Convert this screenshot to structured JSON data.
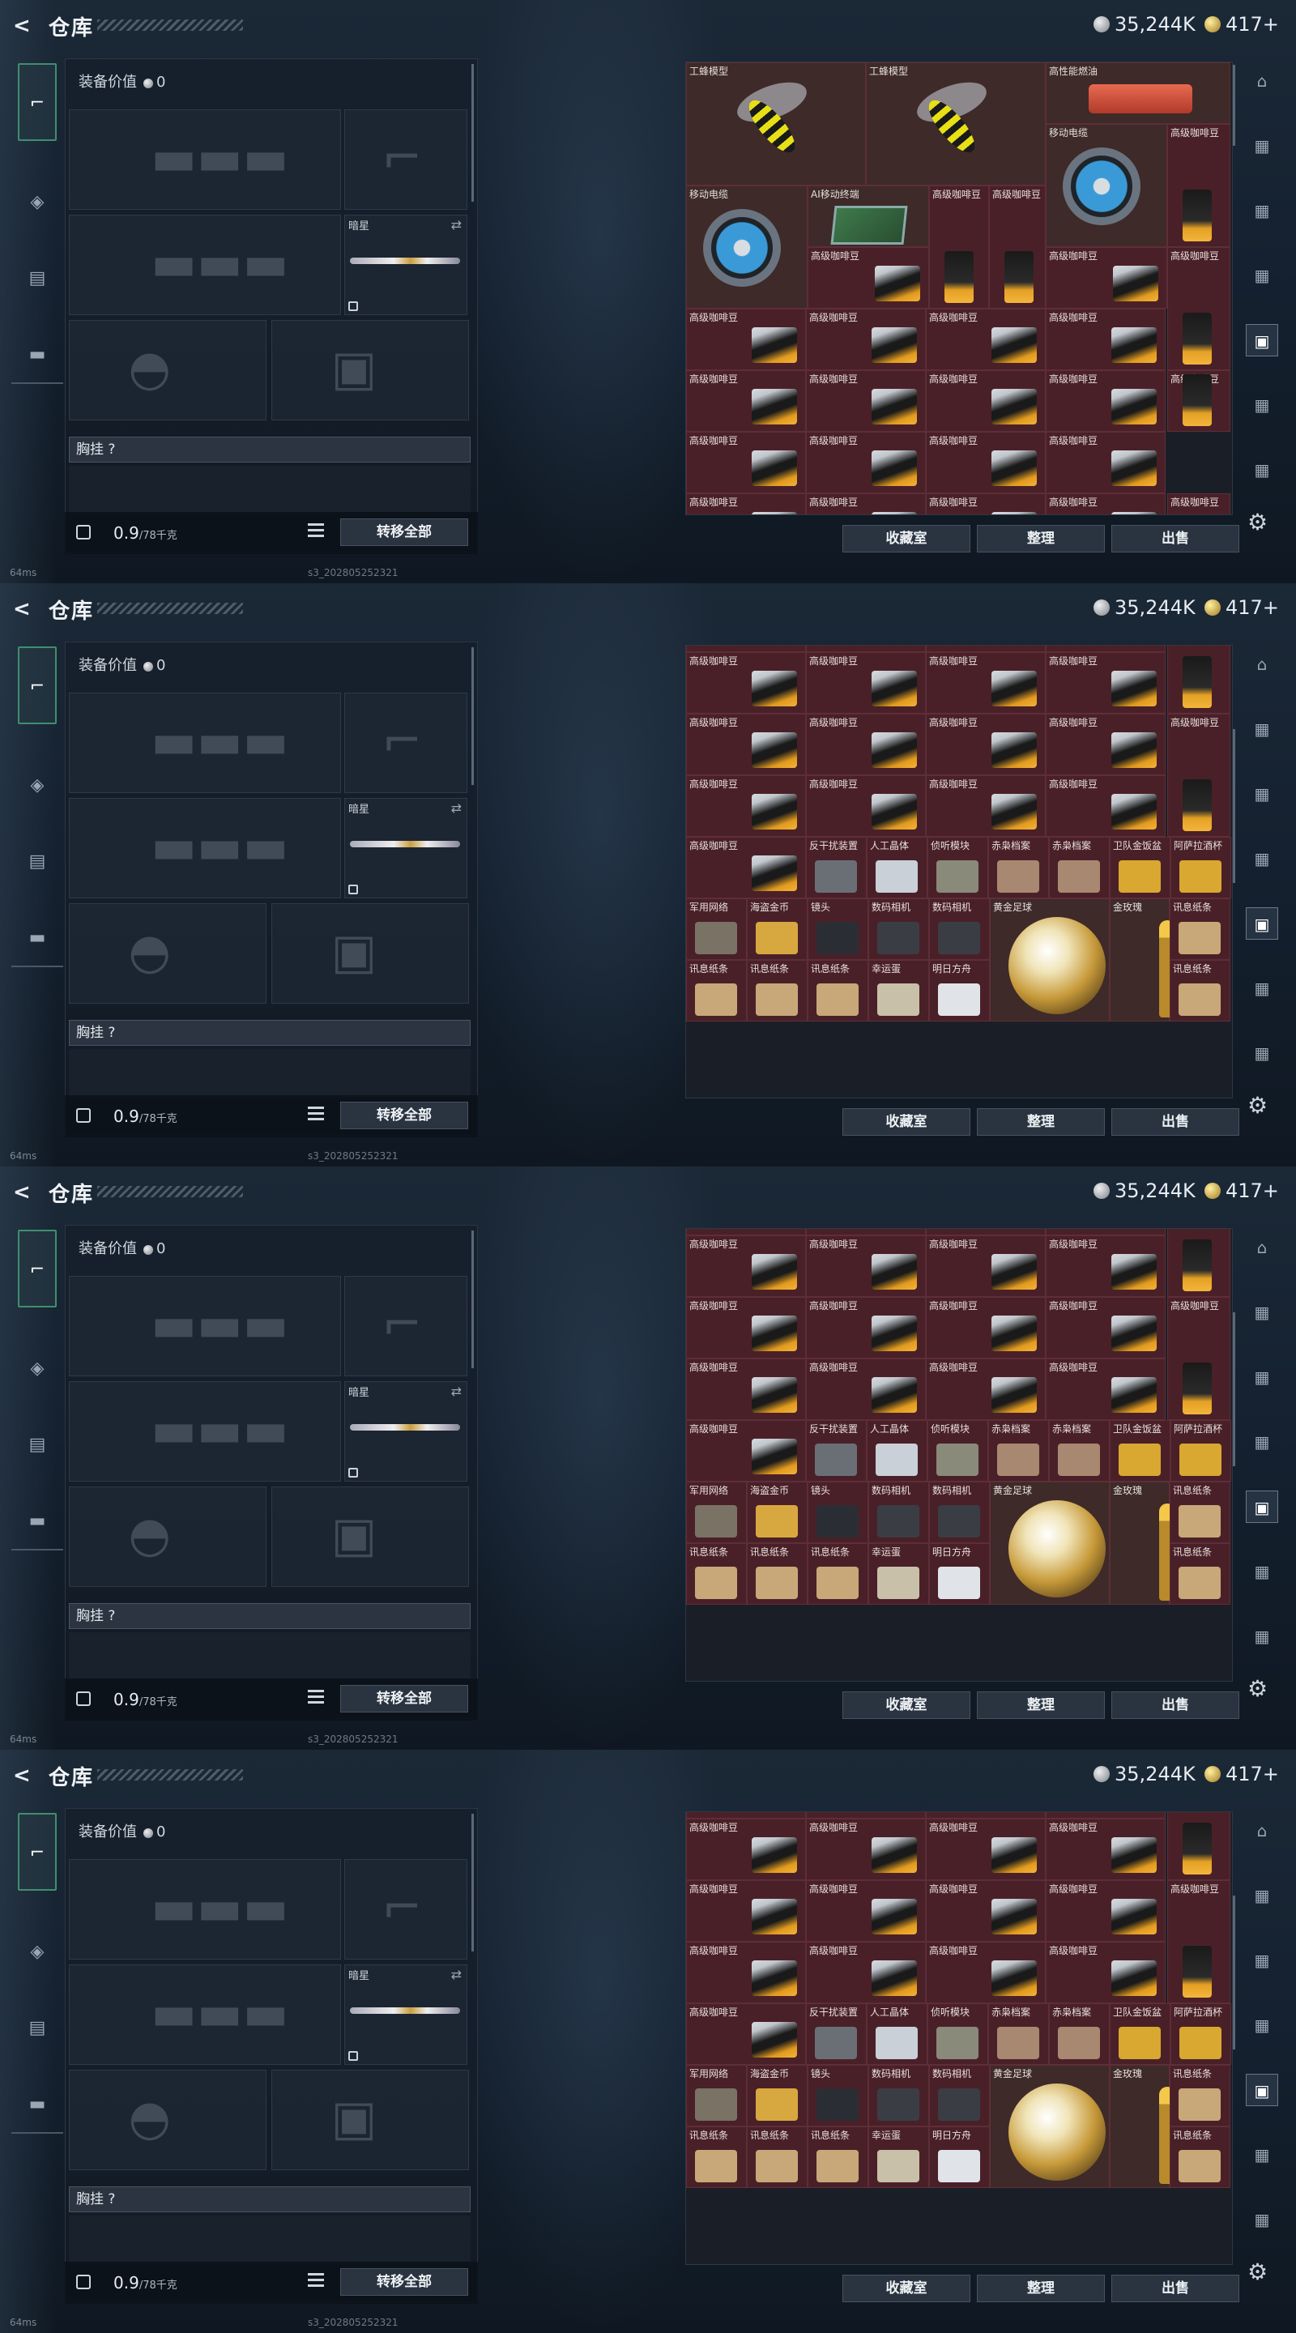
{
  "app": {
    "title": "仓库",
    "back": "<",
    "silver": "35,244K",
    "gold": "417+",
    "ping": "64ms",
    "session": "s3_202805252321"
  },
  "equip": {
    "label": "装备价值",
    "value": "0",
    "melee_name": "暗星",
    "chest_label": "胸挂 ?",
    "weight": "0.9",
    "weight_max": "/78千克",
    "transfer": "转移全部"
  },
  "tabs": [
    "weapon-icon",
    "helmet-icon",
    "vest-icon",
    "case-icon"
  ],
  "stash_buttons": {
    "vault": "收藏室",
    "sort": "整理",
    "sell": "出售"
  },
  "names": {
    "wasp": "工蜂模型",
    "fuel": "高性能燃油",
    "reel": "移动电缆",
    "bean": "高级咖啡豆",
    "ai": "AI移动终端",
    "anti": "反干扰装置",
    "gem": "人工晶体",
    "mod": "侦听模块",
    "bao1": "赤枭档案",
    "cup": "卫队金饭盆",
    "wine": "阿萨拉酒杯",
    "ring": "军用网络",
    "coin": "海盗金币",
    "lens": "镜头",
    "cam": "数码相机",
    "ball": "黄金足球",
    "rose": "金玫瑰",
    "note": "讯息纸条",
    "egg": "幸运蛋",
    "card": "明日方舟"
  },
  "frames": [
    {
      "view": "top"
    },
    {
      "view": "bottom1"
    },
    {
      "view": "bottom2"
    },
    {
      "view": "bottom3"
    }
  ],
  "colors": {
    "accent": "#3f8f6f",
    "cell": "#4a2028"
  }
}
